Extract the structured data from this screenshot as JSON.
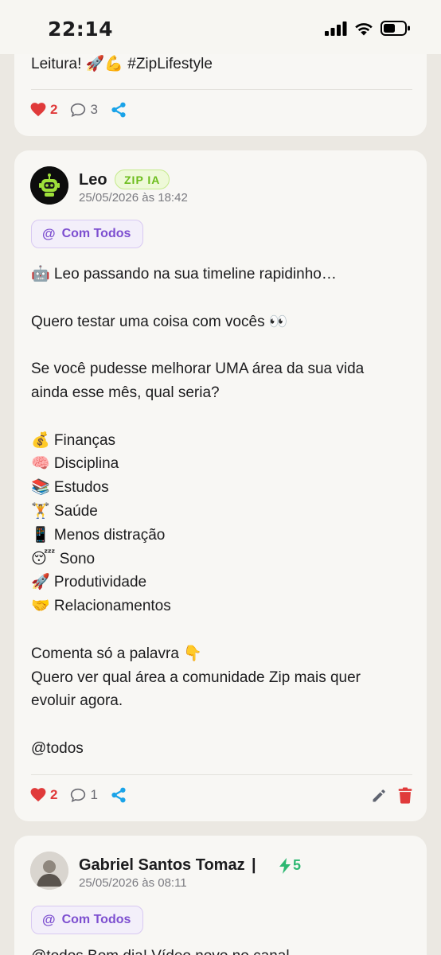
{
  "status_bar": {
    "time": "22:14"
  },
  "top_post": {
    "text": "Leitura! 🚀💪 #ZipLifestyle",
    "likes": "2",
    "comments": "3"
  },
  "main_post": {
    "author": "Leo",
    "badge": "ZIP IA",
    "date": "25/05/2026 às 18:42",
    "audience_label": "Com Todos",
    "audience_symbol": "@",
    "lines": [
      "🤖 Leo passando na sua timeline rapidinho…",
      "",
      "Quero testar uma coisa com vocês 👀",
      "",
      "Se você pudesse melhorar UMA área da sua vida",
      "ainda esse mês, qual seria?",
      "",
      "💰 Finanças",
      "🧠 Disciplina",
      "📚 Estudos",
      "🏋️ Saúde",
      "📱 Menos distração",
      "😴 Sono",
      "🚀 Produtividade",
      "🤝 Relacionamentos",
      "",
      "Comenta só a palavra 👇",
      "Quero ver qual área a comunidade Zip mais quer",
      "evoluir agora.",
      "",
      "@todos"
    ],
    "likes": "2",
    "comments": "1"
  },
  "bottom_post": {
    "author": "Gabriel Santos Tomaz",
    "separator": "|",
    "bolt_count": "5",
    "date": "25/05/2026 às 08:11",
    "audience_label": "Com Todos",
    "audience_symbol": "@",
    "text_preview": "@todos Bom dia! Vídeo novo no canal"
  },
  "colors": {
    "like": "#e03a3a",
    "share": "#1aa3e8",
    "badge_green": "#6cbd1c",
    "audience_purple": "#7d4fd0",
    "bolt_green": "#2eb872"
  }
}
